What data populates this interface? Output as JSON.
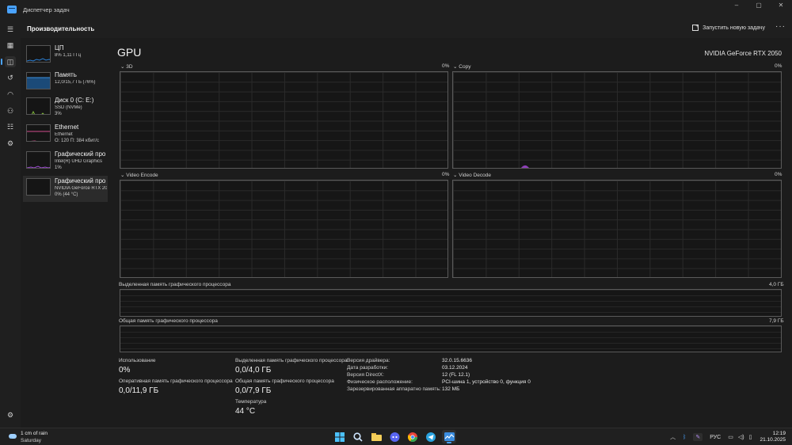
{
  "window": {
    "title": "Диспетчер задач",
    "controls": [
      "–",
      "▢",
      "✕"
    ]
  },
  "header": {
    "page_title": "Производительность",
    "run_task_label": "Запустить новую задачу",
    "more": "···"
  },
  "rail": {
    "items": [
      {
        "icon": "hamburger-icon"
      },
      {
        "icon": "processes-icon"
      },
      {
        "icon": "performance-icon",
        "active": true
      },
      {
        "icon": "app-history-icon"
      },
      {
        "icon": "startup-apps-icon"
      },
      {
        "icon": "users-icon"
      },
      {
        "icon": "details-icon"
      },
      {
        "icon": "services-icon"
      },
      {
        "icon": "settings-icon"
      }
    ]
  },
  "resources": [
    {
      "name": "ЦП",
      "line2": "8% 1,11 ГГц",
      "line3": "",
      "color": "#2b7fd4"
    },
    {
      "name": "Память",
      "line2": "12,0/15,7 ГБ (76%)",
      "line3": "",
      "color": "#2b7fd4"
    },
    {
      "name": "Диск 0 (C: E:)",
      "line2": "SSD (NVMe)",
      "line3": "3%",
      "color": "#7fb83a"
    },
    {
      "name": "Ethernet",
      "line2": "Ethernet",
      "line3": "О: 120 П: 384 кбит/с",
      "color": "#d04a8a"
    },
    {
      "name": "Графический про",
      "line2": "Intel(R) UHD Graphics",
      "line3": "1%",
      "color": "#9c4ad0"
    },
    {
      "name": "Графический про",
      "line2": "NVIDIA GeForce RTX 205",
      "line3": "0% (44 °C)",
      "color": "#9c4ad0",
      "active": true
    }
  ],
  "main": {
    "title": "GPU",
    "model": "NVIDIA GeForce RTX 2050",
    "engines": [
      {
        "label": "3D",
        "value": "0%"
      },
      {
        "label": "Copy",
        "value": "0%"
      },
      {
        "label": "Video Encode",
        "value": "0%"
      },
      {
        "label": "Video Decode",
        "value": "0%"
      }
    ],
    "dedicated_mem_graph": {
      "label": "Выделенная память графического процессора",
      "max": "4,0 ГБ"
    },
    "shared_mem_graph": {
      "label": "Общая память графического процессора",
      "max": "7,9 ГБ"
    }
  },
  "stats": {
    "utilization_label": "Использование",
    "utilization_value": "0%",
    "gpu_mem_label": "Оперативная память графического процессора",
    "gpu_mem_value": "0,0/11,9 ГБ",
    "dedicated_label": "Выделенная память графического процессора",
    "dedicated_value": "0,0/4,0 ГБ",
    "shared_label": "Общая память графического процессора",
    "shared_value": "0,0/7,9 ГБ",
    "temp_label": "Температура",
    "temp_value": "44 °C"
  },
  "details": [
    {
      "key": "Версия драйвера:",
      "value": "32.0.15.6636"
    },
    {
      "key": "Дата разработки:",
      "value": "03.12.2024"
    },
    {
      "key": "Версия DirectX:",
      "value": "12 (FL 12.1)"
    },
    {
      "key": "Физическое расположение:",
      "value": "PCI-шина 1, устройство 0, функция 0"
    },
    {
      "key": "Зарезервированная аппаратно память:",
      "value": "132 МБ"
    }
  ],
  "taskbar": {
    "weather_line1": "1 cm of rain",
    "weather_line2": "Saturday",
    "apps": [
      "windows-start-icon",
      "search-icon",
      "file-explorer-icon",
      "discord-icon",
      "chrome-icon",
      "telegram-icon",
      "task-manager-icon"
    ],
    "tray": [
      "chevron-up-icon",
      "bluetooth-icon",
      "pen-icon"
    ],
    "language": "РУС",
    "time": "12:19",
    "date": "21.10.2025"
  }
}
